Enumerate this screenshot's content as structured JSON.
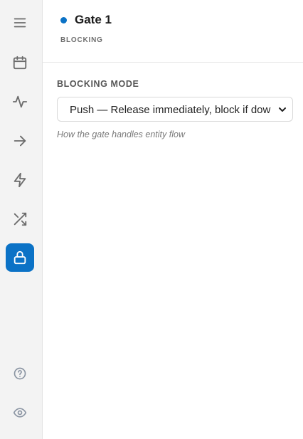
{
  "sidebar": {
    "items": [
      {
        "icon": "menu-icon",
        "active": false
      },
      {
        "icon": "calendar-icon",
        "active": false
      },
      {
        "icon": "activity-icon",
        "active": false
      },
      {
        "icon": "arrow-right-icon",
        "active": false
      },
      {
        "icon": "lightning-icon",
        "active": false
      },
      {
        "icon": "shuffle-icon",
        "active": false
      },
      {
        "icon": "lock-icon",
        "active": true
      }
    ],
    "footer_items": [
      {
        "icon": "help-circle-icon"
      },
      {
        "icon": "eye-icon"
      }
    ],
    "accent_color": "#0b72c6"
  },
  "header": {
    "title": "Gate 1",
    "subtitle": "BLOCKING",
    "status_color": "#0b72c6"
  },
  "form": {
    "blocking_mode": {
      "label": "BLOCKING MODE",
      "value": "Push — Release immediately, block if down",
      "help": "How the gate handles entity flow"
    }
  }
}
